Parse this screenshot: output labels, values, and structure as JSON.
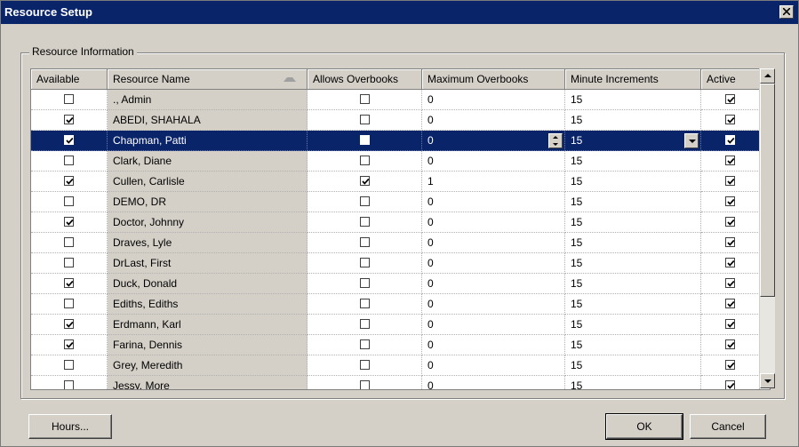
{
  "window": {
    "title": "Resource Setup"
  },
  "group": {
    "label": "Resource Information"
  },
  "columns": [
    "Available",
    "Resource Name",
    "Allows Overbooks",
    "Maximum Overbooks",
    "Minute Increments",
    "Active"
  ],
  "rows": [
    {
      "available": false,
      "name": "., Admin",
      "allows_overbooks": false,
      "max_overbooks": "0",
      "minute_increments": "15",
      "active": true
    },
    {
      "available": true,
      "name": "ABEDI, SHAHALA",
      "allows_overbooks": false,
      "max_overbooks": "0",
      "minute_increments": "15",
      "active": true
    },
    {
      "available": true,
      "name": "Chapman, Patti",
      "allows_overbooks": false,
      "max_overbooks": "0",
      "minute_increments": "15",
      "active": true,
      "selected": true
    },
    {
      "available": false,
      "name": "Clark, Diane",
      "allows_overbooks": false,
      "max_overbooks": "0",
      "minute_increments": "15",
      "active": true
    },
    {
      "available": true,
      "name": "Cullen, Carlisle",
      "allows_overbooks": true,
      "max_overbooks": "1",
      "minute_increments": "15",
      "active": true
    },
    {
      "available": false,
      "name": "DEMO, DR",
      "allows_overbooks": false,
      "max_overbooks": "0",
      "minute_increments": "15",
      "active": true
    },
    {
      "available": true,
      "name": "Doctor, Johnny",
      "allows_overbooks": false,
      "max_overbooks": "0",
      "minute_increments": "15",
      "active": true
    },
    {
      "available": false,
      "name": "Draves, Lyle",
      "allows_overbooks": false,
      "max_overbooks": "0",
      "minute_increments": "15",
      "active": true
    },
    {
      "available": false,
      "name": "DrLast, First",
      "allows_overbooks": false,
      "max_overbooks": "0",
      "minute_increments": "15",
      "active": true
    },
    {
      "available": true,
      "name": "Duck, Donald",
      "allows_overbooks": false,
      "max_overbooks": "0",
      "minute_increments": "15",
      "active": true
    },
    {
      "available": false,
      "name": "Ediths, Ediths",
      "allows_overbooks": false,
      "max_overbooks": "0",
      "minute_increments": "15",
      "active": true
    },
    {
      "available": true,
      "name": "Erdmann, Karl",
      "allows_overbooks": false,
      "max_overbooks": "0",
      "minute_increments": "15",
      "active": true
    },
    {
      "available": true,
      "name": "Farina, Dennis",
      "allows_overbooks": false,
      "max_overbooks": "0",
      "minute_increments": "15",
      "active": true
    },
    {
      "available": false,
      "name": "Grey, Meredith",
      "allows_overbooks": false,
      "max_overbooks": "0",
      "minute_increments": "15",
      "active": true
    },
    {
      "available": false,
      "name": "Jessy, More",
      "allows_overbooks": false,
      "max_overbooks": "0",
      "minute_increments": "15",
      "active": true
    }
  ],
  "buttons": {
    "hours": "Hours...",
    "ok": "OK",
    "cancel": "Cancel"
  },
  "icons": {
    "close": "close-icon",
    "check": "checkmark-icon",
    "sort": "sort-ascending-icon",
    "spin": "spinner-icon",
    "dropdown": "chevron-down-icon"
  },
  "colors": {
    "title_bar": "#0a246a",
    "selection": "#0a246a",
    "face": "#d4d0c8"
  }
}
